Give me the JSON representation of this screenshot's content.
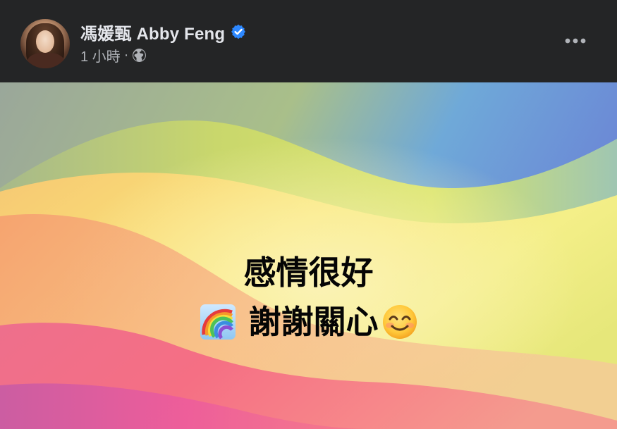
{
  "post": {
    "author": "馮媛甄 Abby Feng",
    "time": "1 小時",
    "separator": "·",
    "privacy_icon": "globe-icon",
    "verified_icon": "verified-badge-icon",
    "more_icon": "more-options-icon"
  },
  "content": {
    "line1": "感情很好",
    "line2": "謝謝關心",
    "emoji_before_line2": "rainbow-emoji",
    "emoji_after_line2": "smiling-face-emoji"
  },
  "colors": {
    "background": "#242526",
    "author_text": "#e4e6eb",
    "meta_text": "#b0b3b8",
    "verified_blue": "#2d88ff",
    "post_text": "#050505"
  }
}
